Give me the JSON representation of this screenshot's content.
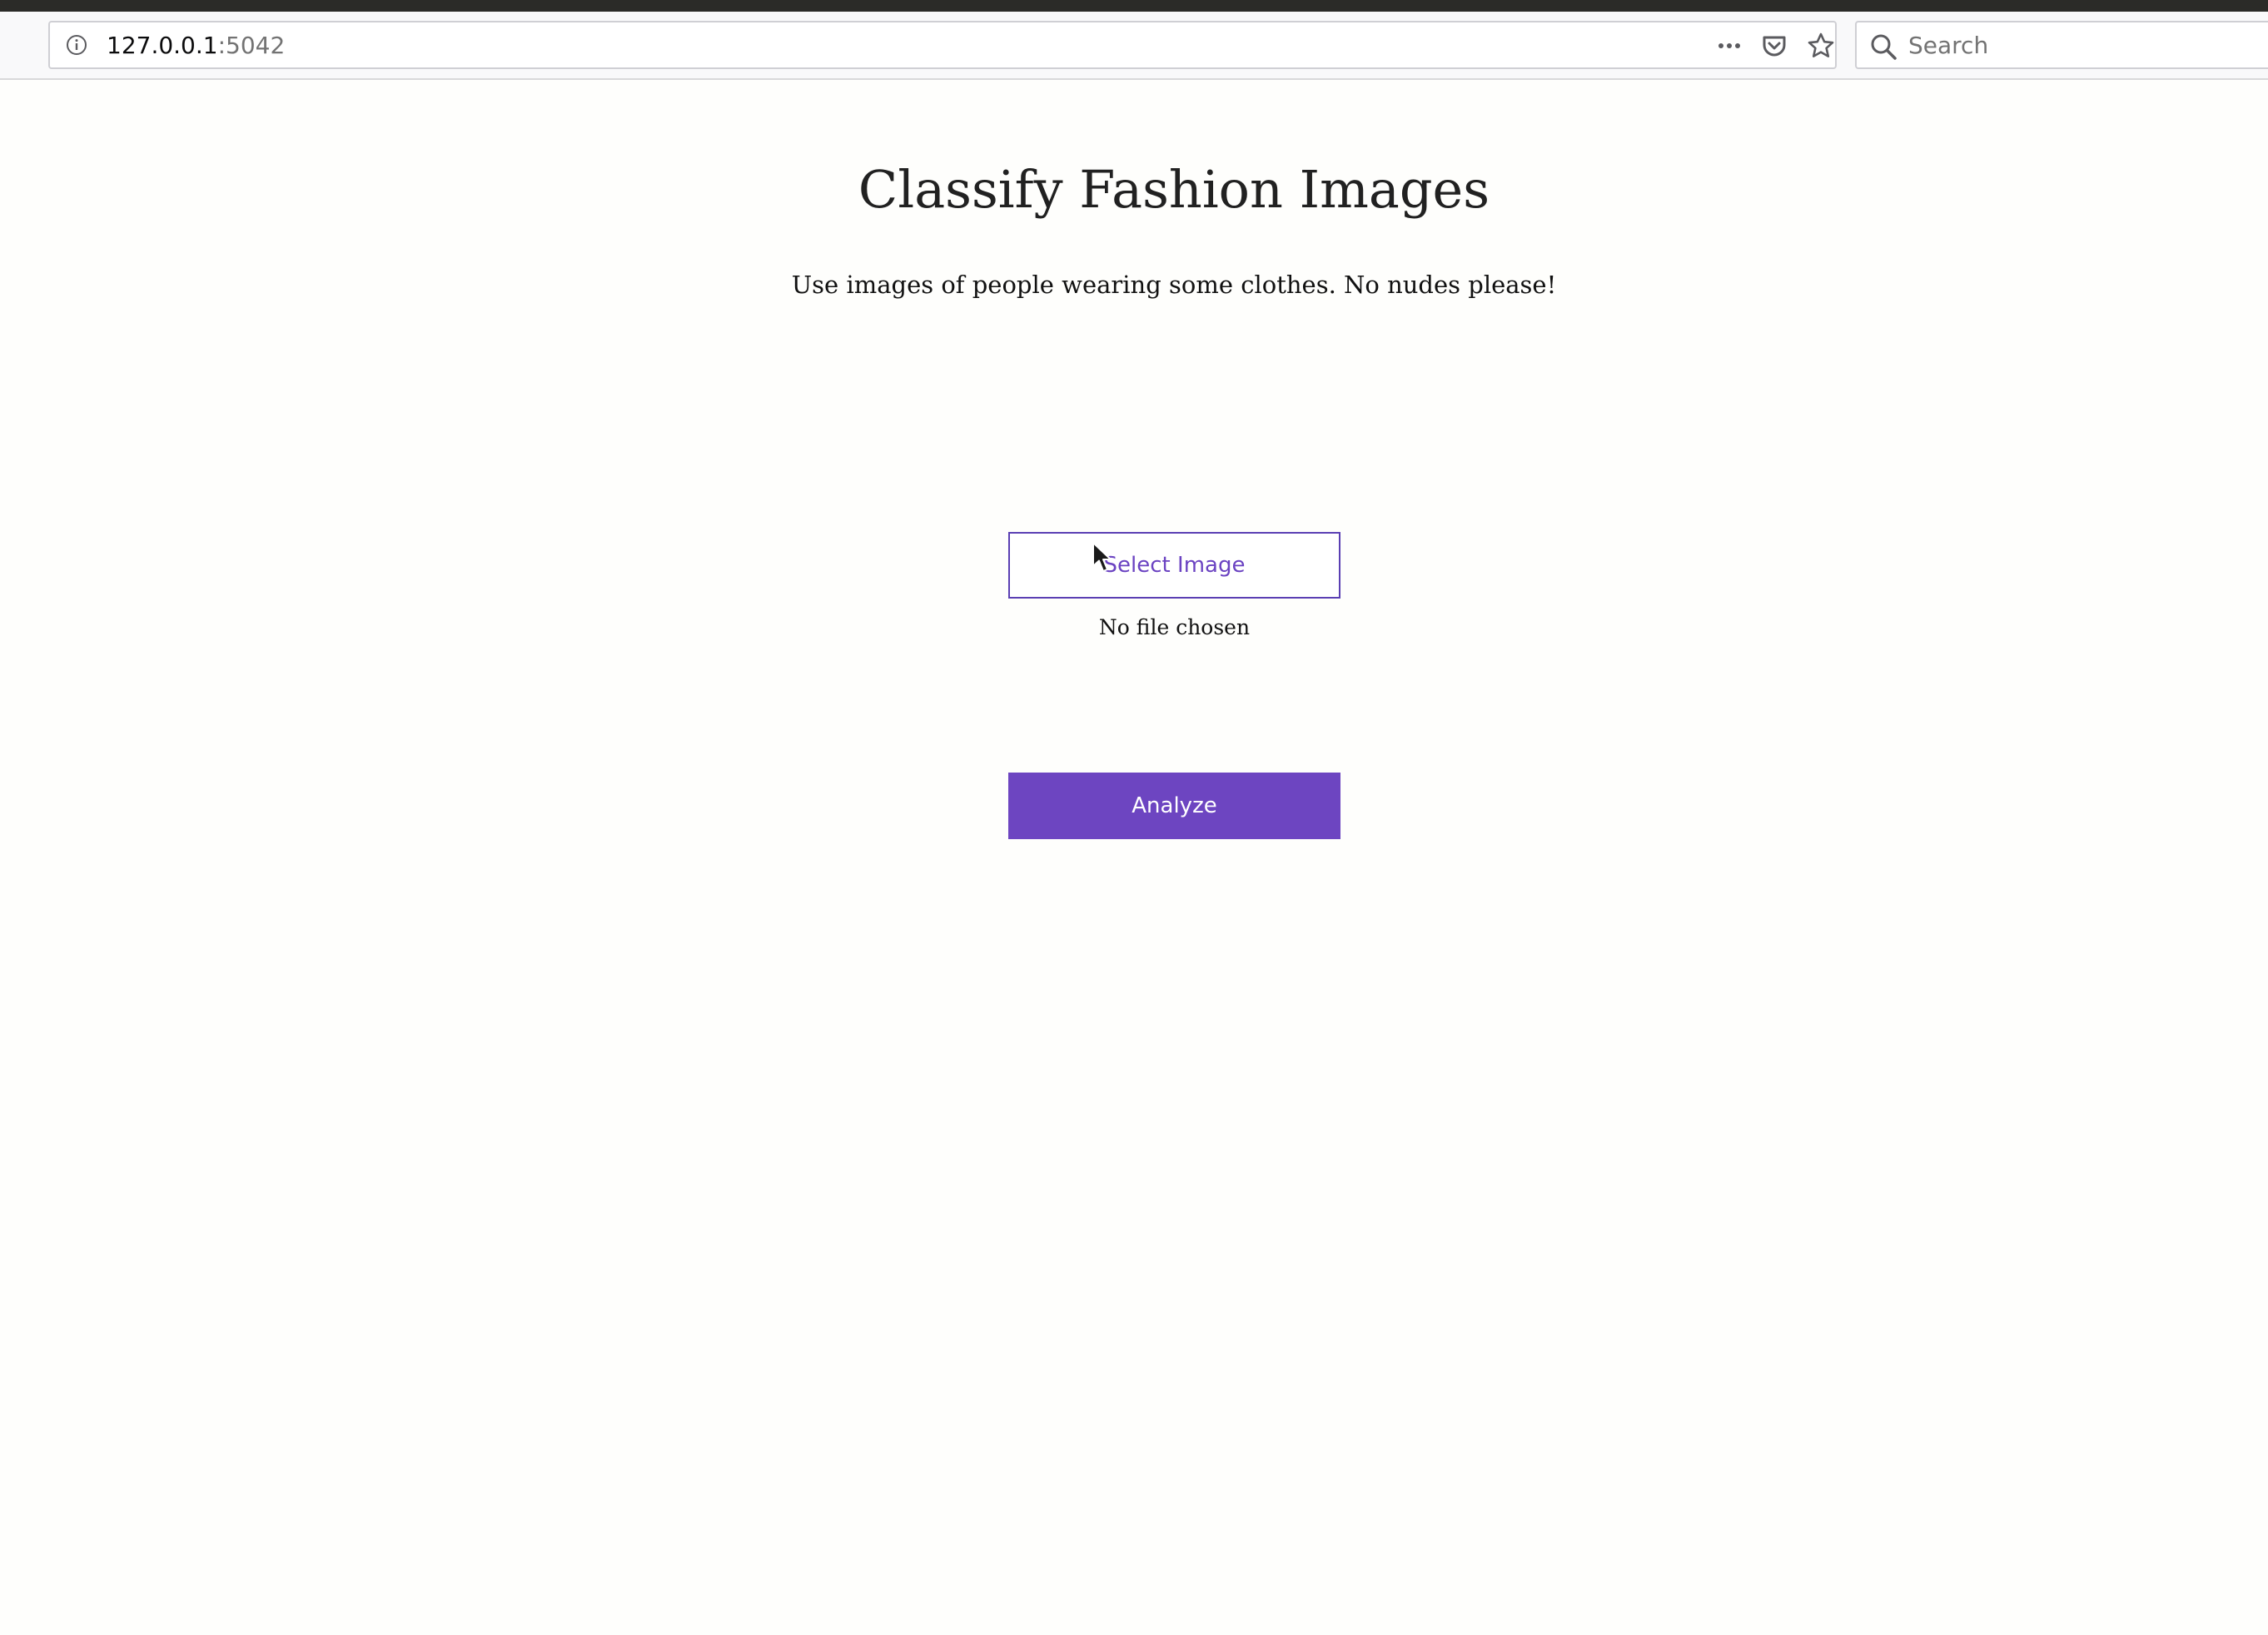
{
  "browser": {
    "url_host": "127.0.0.1",
    "url_port": ":5042",
    "search_placeholder": "Search",
    "icons": [
      "info-icon",
      "more-actions-icon",
      "pocket-icon",
      "bookmark-star-icon",
      "search-icon"
    ]
  },
  "main": {
    "title": "Classify Fashion Images",
    "subtitle": "Use images of people wearing some clothes. No nudes please!",
    "select_label": "Select Image",
    "file_status": "No file chosen",
    "analyze_label": "Analyze"
  },
  "colors": {
    "accent": "#6d45c1",
    "select_border": "#5a3fb3",
    "select_text": "#6b43c2",
    "background": "#fefefc"
  }
}
